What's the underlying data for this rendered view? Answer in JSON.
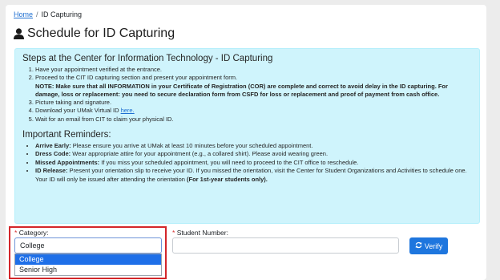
{
  "breadcrumb": {
    "home": "Home",
    "separator": "/",
    "current": "ID Capturing"
  },
  "page": {
    "title": "Schedule for ID Capturing",
    "title_icon": "user-icon"
  },
  "steps": {
    "heading": "Steps at the Center for Information Technology - ID Capturing",
    "items": [
      "Have your appointment verified at the entrance.",
      "Proceed to the CIT ID capturing section and present your appointment form.",
      "Picture taking and signature.",
      "Download your UMak Virtual ID",
      "Wait for an email from CIT to claim your physical ID."
    ],
    "note": "NOTE: Make sure that all INFORMATION in your Certificate of Registration (COR) are complete and correct to avoid delay in the ID capturing. For damage, loss or replacement: you need to secure declaration form from CSFD for loss or replacement and proof of payment from cash office.",
    "download_link": "here."
  },
  "reminders": {
    "heading": "Important Reminders:",
    "items": [
      {
        "label": "Arrive Early:",
        "text": "Please ensure you arrive at UMak at least 10 minutes before your scheduled appointment."
      },
      {
        "label": "Dress Code:",
        "text": "Wear appropriate attire for your appointment (e.g., a collared shirt). Please avoid wearing green."
      },
      {
        "label": "Missed Appointments:",
        "text": "If you miss your scheduled appointment, you will need to proceed to the CIT office to reschedule."
      },
      {
        "label": "ID Release:",
        "text": "Present your orientation slip to receive your ID. If you missed the orientation, visit the Center for Student Organizations and Activities to schedule one. Your ID will only be issued after attending the orientation",
        "bold_tail": "(For 1st-year students only)."
      }
    ]
  },
  "form": {
    "category_label": "Category:",
    "category_value": "College",
    "category_options": [
      "College",
      "Senior High"
    ],
    "student_number_label": "Student Number:",
    "student_number_value": "",
    "required_mark": "*",
    "verify_label": "Verify",
    "verify_icon": "sync-icon"
  },
  "colors": {
    "accent": "#1e76de",
    "info_bg": "#cff4fc",
    "highlight": "#d3262a"
  }
}
